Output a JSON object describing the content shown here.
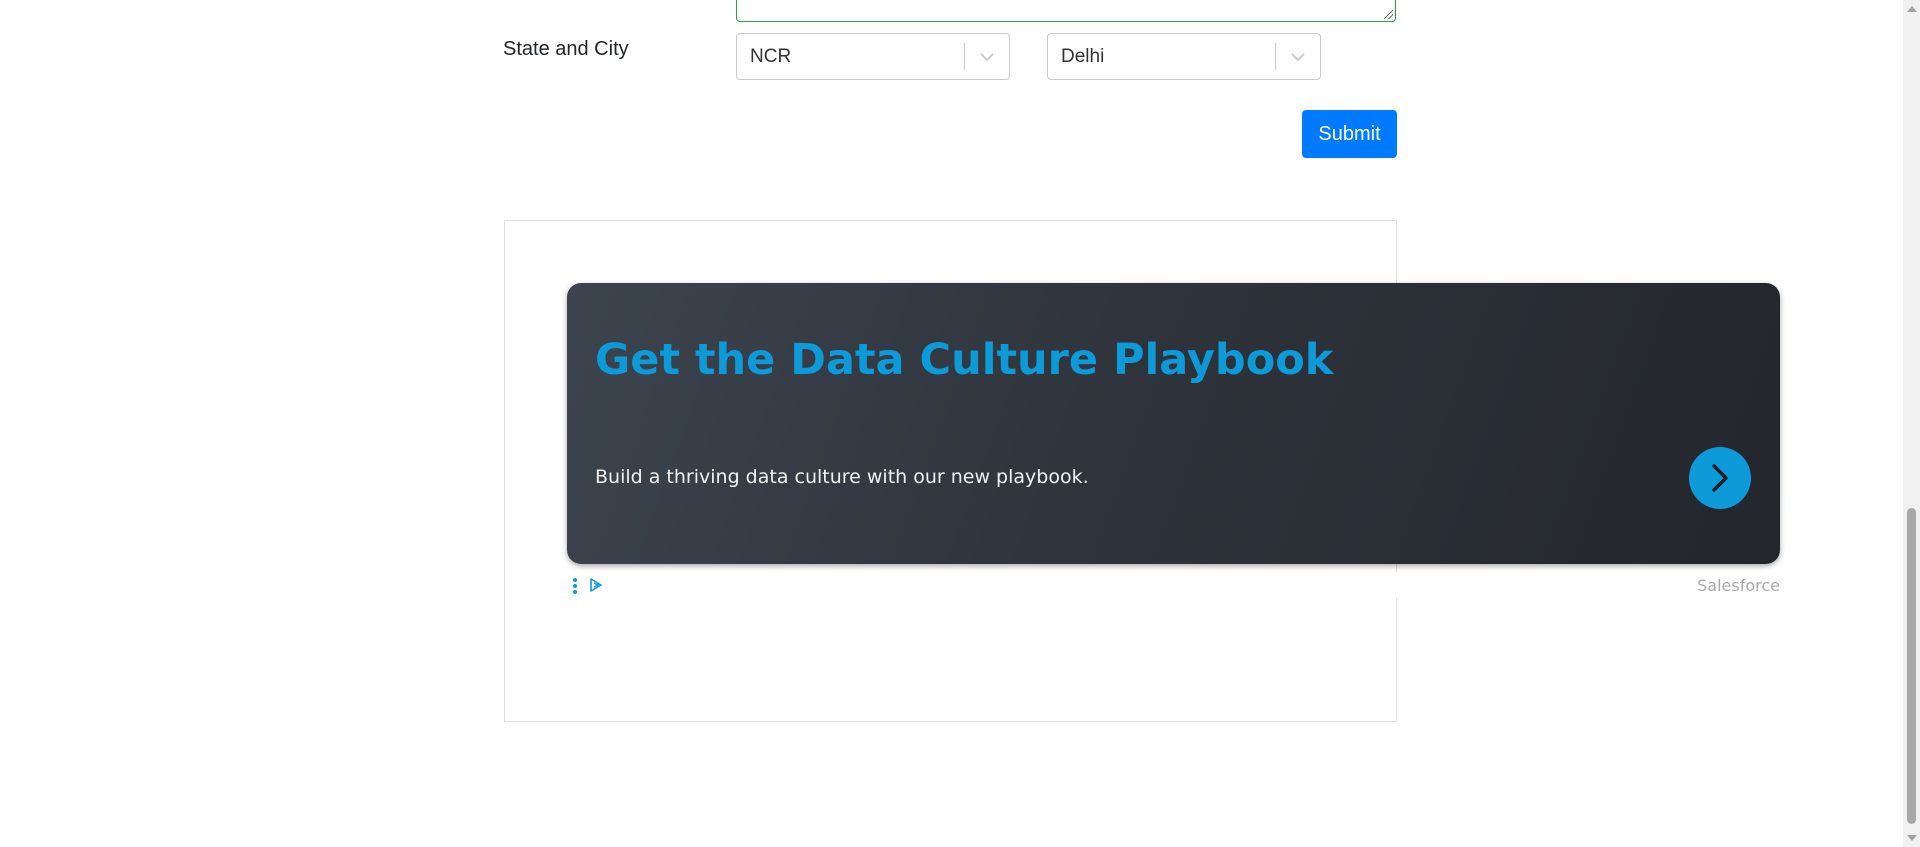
{
  "form": {
    "state_city_label": "State and City",
    "state_select": {
      "value": "NCR"
    },
    "city_select": {
      "value": "Delhi"
    },
    "submit_label": "Submit"
  },
  "ad": {
    "title": "Get the Data Culture Playbook",
    "description": "Build a thriving data culture with our new playbook.",
    "advertiser": "Salesforce",
    "icons": [
      "chevron-right-icon",
      "menu-dots-icon",
      "adchoices-icon"
    ],
    "colors": {
      "title": "#0d9ad8",
      "card_bg": "#2f343c",
      "button": "#0d9ad8"
    }
  },
  "colors": {
    "primary_button": "#007bff",
    "valid_border": "#28a745"
  }
}
